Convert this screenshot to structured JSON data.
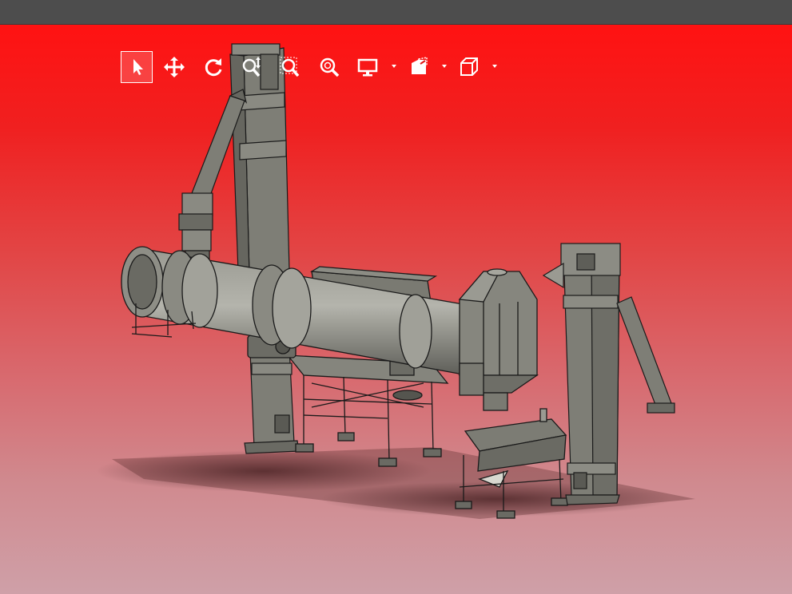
{
  "window": {
    "title_bar_color": "#4d4d4d"
  },
  "viewport": {
    "background_top": "#ff1212",
    "background_bottom": "#cfa0a8"
  },
  "toolbar": {
    "tools": [
      {
        "icon": "select-arrow-icon",
        "active": true
      },
      {
        "icon": "pan-move-icon",
        "active": false
      },
      {
        "icon": "rotate-icon",
        "active": false
      },
      {
        "icon": "zoom-in-out-icon",
        "active": false
      },
      {
        "icon": "zoom-window-icon",
        "active": false
      },
      {
        "icon": "zoom-fit-icon",
        "active": false
      },
      {
        "icon": "display-mode-icon",
        "active": false,
        "dropdown": true
      },
      {
        "icon": "section-view-icon",
        "active": false,
        "dropdown": true
      },
      {
        "icon": "view-orientation-cube-icon",
        "active": false,
        "dropdown": true
      }
    ]
  },
  "model": {
    "description_icon": "rotary-dryer-plant-3d-model",
    "components": [
      "left-bucket-elevator",
      "feed-chute",
      "rotary-drum",
      "drum-support-frame",
      "cyclone-dust-collector",
      "vibrating-screen",
      "right-bucket-elevator"
    ],
    "body_color": "#7e7e76",
    "edge_color": "#1a1a1a"
  }
}
